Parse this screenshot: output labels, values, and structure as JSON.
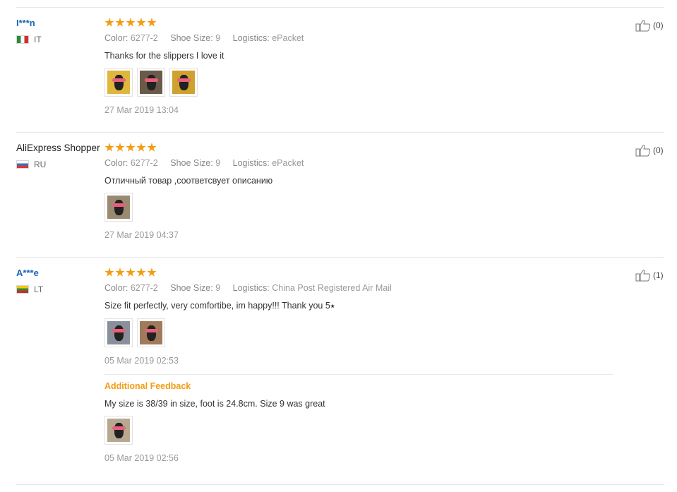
{
  "reviews": [
    {
      "user": "I***n",
      "country": "IT",
      "rating": 5,
      "attrs": {
        "color_label": "Color:",
        "color_value": "6277-2",
        "size_label": "Shoe Size:",
        "size_value": "9",
        "logistics_label": "Logistics:",
        "logistics_value": "ePacket"
      },
      "content": "Thanks for the slippers I love it",
      "date": "27 Mar 2019 13:04",
      "helpful": "(0)"
    },
    {
      "user": "AliExpress Shopper",
      "country": "RU",
      "rating": 5,
      "attrs": {
        "color_label": "Color:",
        "color_value": "6277-2",
        "size_label": "Shoe Size:",
        "size_value": "9",
        "logistics_label": "Logistics:",
        "logistics_value": "ePacket"
      },
      "content": "Отличный товар ,соответсвует описанию",
      "date": "27 Mar 2019 04:37",
      "helpful": "(0)"
    },
    {
      "user": "A***e",
      "country": "LT",
      "rating": 5,
      "attrs": {
        "color_label": "Color:",
        "color_value": "6277-2",
        "size_label": "Shoe Size:",
        "size_value": "9",
        "logistics_label": "Logistics:",
        "logistics_value": "China Post Registered Air Mail"
      },
      "content": "Size fit perfectly, very comfortibe, im happy!!! Thank you 5⭑",
      "date": "05 Mar 2019 02:53",
      "helpful": "(1)",
      "additional": {
        "title": "Additional Feedback",
        "content": "My size is 38/39 in size, foot is 24.8cm. Size 9 was great",
        "date": "05 Mar 2019 02:56"
      }
    }
  ],
  "colors": {
    "accent": "#f39c12",
    "username": "#1a65b3",
    "muted": "#999999"
  },
  "icons": {
    "helpful": "thumbs-up-icon",
    "rating": "star-icon"
  }
}
